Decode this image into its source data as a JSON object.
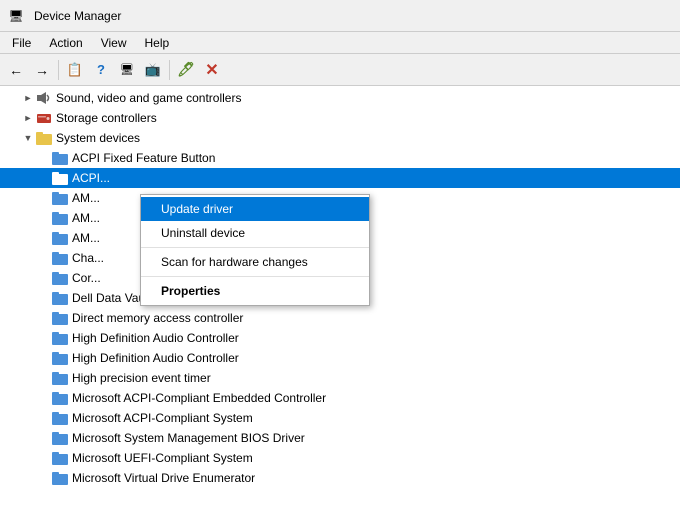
{
  "titleBar": {
    "title": "Device Manager",
    "icon": "computer"
  },
  "menuBar": {
    "items": [
      "File",
      "Action",
      "View",
      "Help"
    ]
  },
  "toolbar": {
    "buttons": [
      "back",
      "forward",
      "up",
      "properties",
      "help",
      "scan",
      "monitor",
      "add",
      "remove"
    ]
  },
  "tree": {
    "items": [
      {
        "id": "sound",
        "label": "Sound, video and game controllers",
        "indent": 1,
        "type": "sound",
        "expanded": false
      },
      {
        "id": "storage",
        "label": "Storage controllers",
        "indent": 1,
        "type": "storage",
        "expanded": false
      },
      {
        "id": "system",
        "label": "System devices",
        "indent": 1,
        "type": "folder",
        "expanded": true
      },
      {
        "id": "acpi-fixed",
        "label": "ACPI Fixed Feature Button",
        "indent": 2,
        "type": "folder-blue"
      },
      {
        "id": "acpi-selected",
        "label": "ACPI...",
        "indent": 2,
        "type": "folder-blue",
        "selected": true
      },
      {
        "id": "am1",
        "label": "AM...",
        "indent": 2,
        "type": "folder-blue"
      },
      {
        "id": "am2",
        "label": "AM...",
        "indent": 2,
        "type": "folder-blue"
      },
      {
        "id": "am3",
        "label": "AM...",
        "indent": 2,
        "type": "folder-blue"
      },
      {
        "id": "cha",
        "label": "Cha...",
        "indent": 2,
        "type": "folder-blue"
      },
      {
        "id": "cor",
        "label": "Cor...",
        "indent": 2,
        "type": "folder-blue"
      },
      {
        "id": "dell",
        "label": "Dell Data Vault Control Device",
        "indent": 2,
        "type": "folder-blue"
      },
      {
        "id": "direct",
        "label": "Direct memory access controller",
        "indent": 2,
        "type": "folder-blue"
      },
      {
        "id": "hda1",
        "label": "High Definition Audio Controller",
        "indent": 2,
        "type": "folder-blue"
      },
      {
        "id": "hda2",
        "label": "High Definition Audio Controller",
        "indent": 2,
        "type": "folder-blue"
      },
      {
        "id": "hpet",
        "label": "High precision event timer",
        "indent": 2,
        "type": "folder-blue"
      },
      {
        "id": "mac-embedded",
        "label": "Microsoft ACPI-Compliant Embedded Controller",
        "indent": 2,
        "type": "folder-blue"
      },
      {
        "id": "mac-system",
        "label": "Microsoft ACPI-Compliant System",
        "indent": 2,
        "type": "folder-blue"
      },
      {
        "id": "msm-bios",
        "label": "Microsoft System Management BIOS Driver",
        "indent": 2,
        "type": "folder-blue"
      },
      {
        "id": "uefi",
        "label": "Microsoft UEFI-Compliant System",
        "indent": 2,
        "type": "folder-blue"
      },
      {
        "id": "mvde",
        "label": "Microsoft Virtual Drive Enumerator",
        "indent": 2,
        "type": "folder-blue"
      }
    ]
  },
  "contextMenu": {
    "items": [
      {
        "id": "update-driver",
        "label": "Update driver",
        "highlighted": true,
        "bold": false
      },
      {
        "id": "uninstall-device",
        "label": "Uninstall device",
        "highlighted": false,
        "bold": false
      },
      {
        "id": "separator",
        "type": "separator"
      },
      {
        "id": "scan-hardware",
        "label": "Scan for hardware changes",
        "highlighted": false,
        "bold": false
      },
      {
        "id": "separator2",
        "type": "separator"
      },
      {
        "id": "properties",
        "label": "Properties",
        "highlighted": false,
        "bold": true
      }
    ]
  }
}
